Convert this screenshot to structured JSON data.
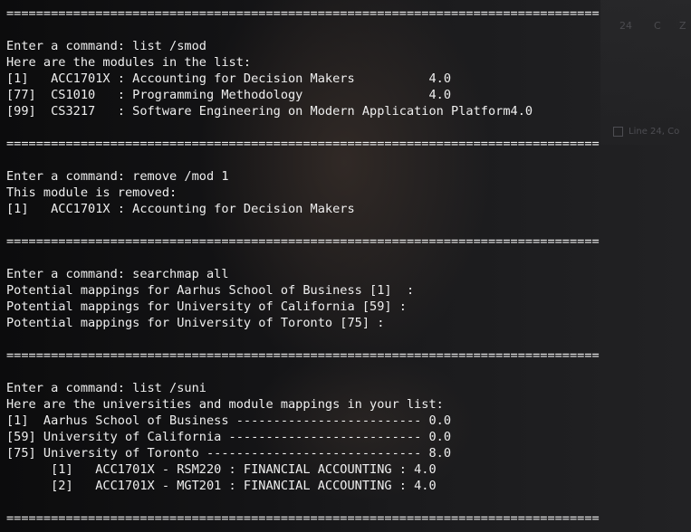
{
  "background": {
    "gutter_numbers": [
      "24",
      "C",
      "Z"
    ],
    "status_text": "Line 24, Co"
  },
  "lines": [
    "================================================================================",
    "",
    "Enter a command: list /smod",
    "Here are the modules in the list:",
    "[1]   ACC1701X : Accounting for Decision Makers          4.0",
    "[77]  CS1010   : Programming Methodology                 4.0",
    "[99]  CS3217   : Software Engineering on Modern Application Platform4.0",
    "",
    "================================================================================",
    "",
    "Enter a command: remove /mod 1",
    "This module is removed:",
    "[1]   ACC1701X : Accounting for Decision Makers",
    "",
    "================================================================================",
    "",
    "Enter a command: searchmap all",
    "Potential mappings for Aarhus School of Business [1]  :",
    "Potential mappings for University of California [59] :",
    "Potential mappings for University of Toronto [75] :",
    "",
    "================================================================================",
    "",
    "Enter a command: list /suni",
    "Here are the universities and module mappings in your list:",
    "[1]  Aarhus School of Business ------------------------- 0.0",
    "[59] University of California -------------------------- 0.0",
    "[75] University of Toronto ----------------------------- 8.0",
    "      [1]   ACC1701X - RSM220 : FINANCIAL ACCOUNTING : 4.0",
    "      [2]   ACC1701X - MGT201 : FINANCIAL ACCOUNTING : 4.0",
    "",
    "================================================================================"
  ]
}
